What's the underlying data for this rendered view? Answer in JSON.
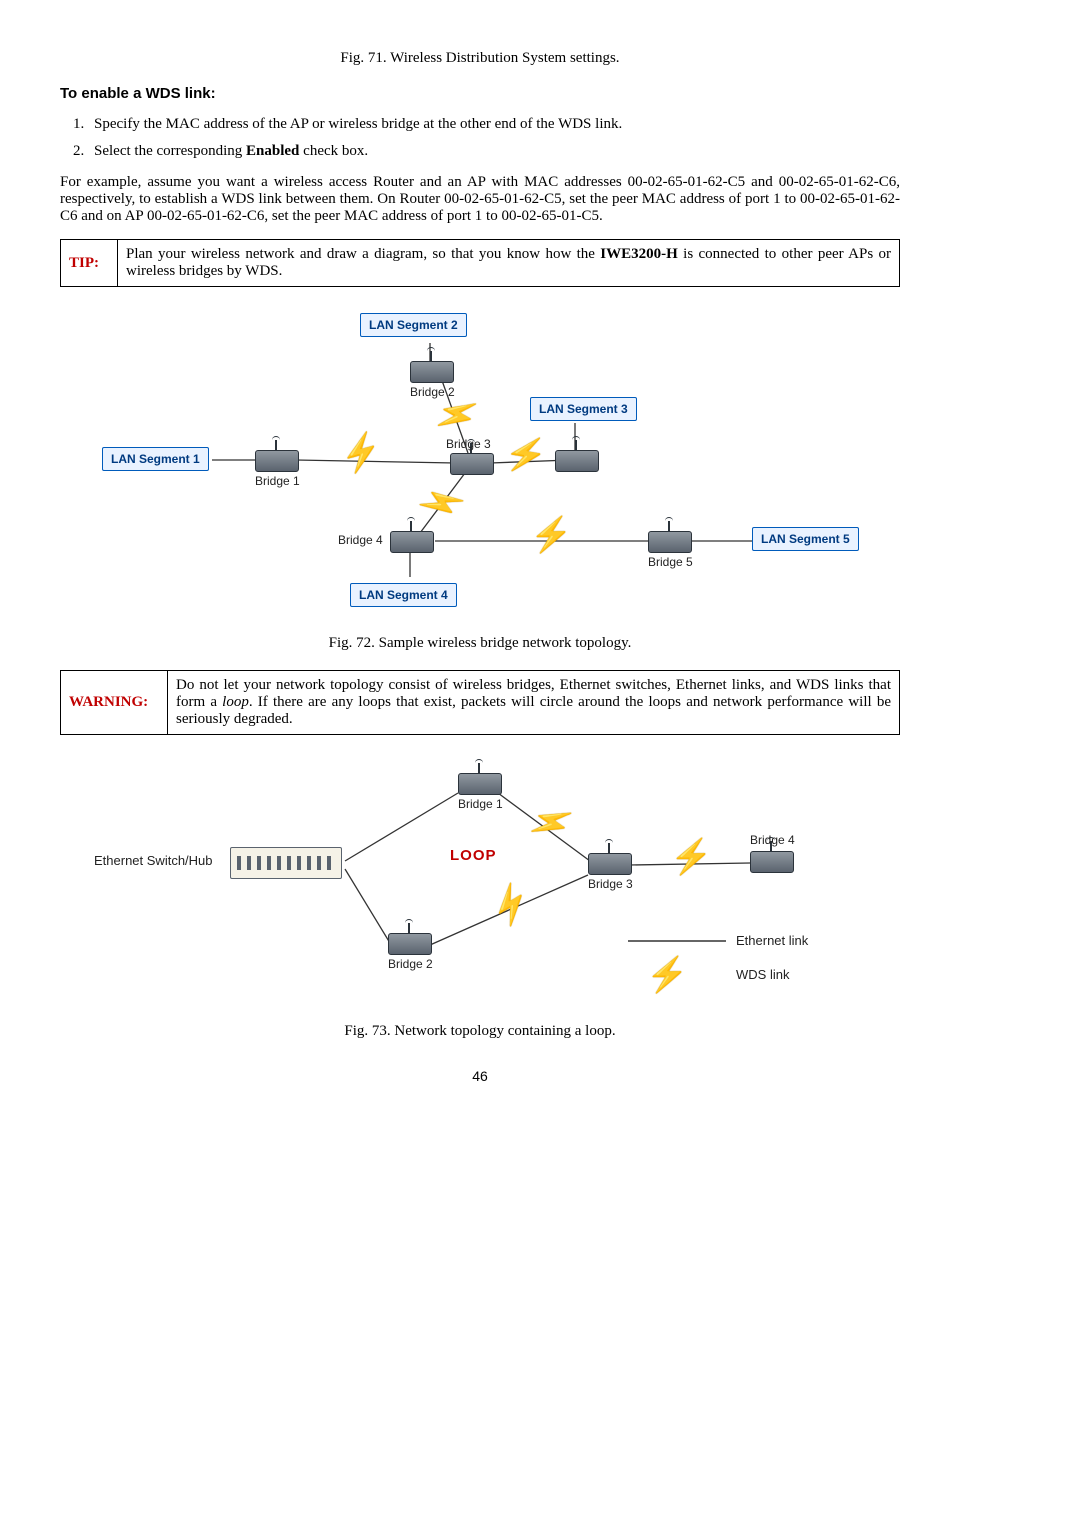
{
  "figs": {
    "top": "Fig. 71. Wireless Distribution System settings.",
    "topo": "Fig. 72. Sample wireless bridge network topology.",
    "loop": "Fig. 73. Network topology containing a loop."
  },
  "heading": "To enable a WDS link:",
  "steps": {
    "s1": "Specify the MAC address of the AP or wireless bridge at the other end of the WDS link.",
    "s2_pre": "Select the corresponding ",
    "s2_bold": "Enabled",
    "s2_post": " check box."
  },
  "para": "For example, assume you want a wireless access Router and an AP with MAC addresses 00-02-65-01-62-C5 and 00-02-65-01-62-C6, respectively, to establish a WDS link between them. On Router 00-02-65-01-62-C5, set the peer MAC address of port 1 to 00-02-65-01-62-C6 and on AP 00-02-65-01-62-C6, set the peer MAC address of port 1 to 00-02-65-01-C5.",
  "tip": {
    "label": "TIP:",
    "pre": "Plan your wireless network and draw a diagram, so that you know how the ",
    "bold": "IWE3200-H",
    "post": " is connected to other peer APs or wireless bridges by WDS."
  },
  "warn": {
    "label": "WARNING:",
    "pre": "Do not let your network topology consist of wireless bridges, Ethernet switches, Ethernet links, and WDS links that form a ",
    "ital": "loop",
    "post": ". If there are any loops that exist, packets will circle around the loops and network performance will be seriously degraded."
  },
  "d1": {
    "seg1": "LAN Segment 1",
    "seg2": "LAN Segment 2",
    "seg3": "LAN Segment 3",
    "seg4": "LAN Segment 4",
    "seg5": "LAN Segment 5",
    "b1": "Bridge 1",
    "b2": "Bridge 2",
    "b3": "Bridge 3",
    "b4": "Bridge 4",
    "b5": "Bridge 5"
  },
  "d2": {
    "hub": "Ethernet Switch/Hub",
    "loop": "LOOP",
    "b1": "Bridge 1",
    "b2": "Bridge 2",
    "b3": "Bridge 3",
    "b4": "Bridge 4",
    "eth": "Ethernet link",
    "wds": "WDS link"
  },
  "page": "46"
}
